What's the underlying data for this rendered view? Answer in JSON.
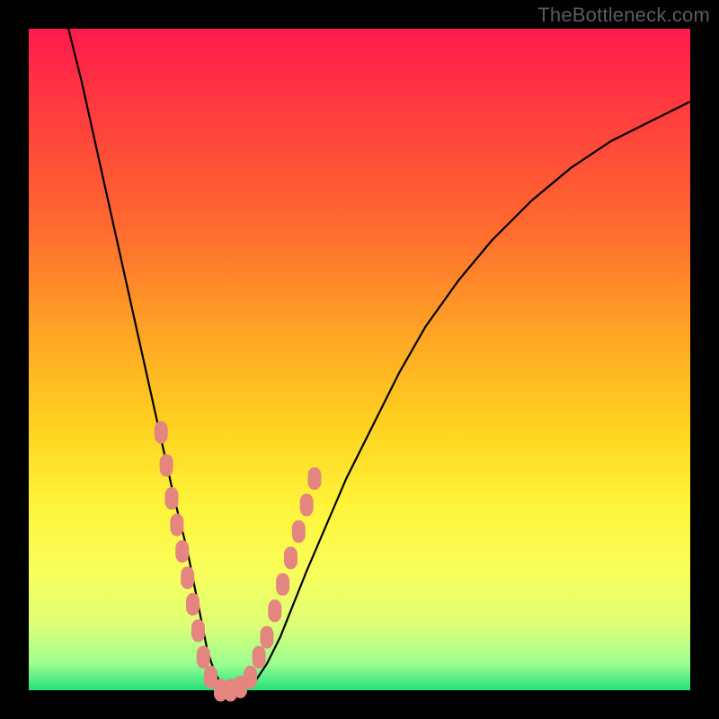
{
  "watermark": "TheBottleneck.com",
  "colors": {
    "frame_bg": "#000000",
    "marker_fill": "#e58580",
    "curve_stroke": "#000000",
    "gradient_top": "#ff1a4d",
    "gradient_bottom": "#23e27a"
  },
  "chart_data": {
    "type": "line",
    "title": "",
    "xlabel": "",
    "ylabel": "",
    "xlim": [
      0,
      100
    ],
    "ylim": [
      0,
      100
    ],
    "grid": false,
    "legend": false,
    "series": [
      {
        "name": "curve",
        "x": [
          6,
          8,
          10,
          12,
          14,
          16,
          18,
          20,
          22,
          23,
          24,
          25,
          26,
          27,
          28,
          29,
          30,
          32,
          34,
          36,
          38,
          40,
          42,
          45,
          48,
          52,
          56,
          60,
          65,
          70,
          76,
          82,
          88,
          94,
          100
        ],
        "y": [
          100,
          92,
          83,
          74,
          65,
          56,
          47,
          38,
          29,
          25,
          21,
          16,
          11,
          6,
          3,
          1,
          0,
          0,
          1,
          4,
          8,
          13,
          18,
          25,
          32,
          40,
          48,
          55,
          62,
          68,
          74,
          79,
          83,
          86,
          89
        ]
      }
    ],
    "markers": [
      {
        "x": 20.0,
        "y": 39
      },
      {
        "x": 20.8,
        "y": 34
      },
      {
        "x": 21.6,
        "y": 29
      },
      {
        "x": 22.4,
        "y": 25
      },
      {
        "x": 23.2,
        "y": 21
      },
      {
        "x": 24.0,
        "y": 17
      },
      {
        "x": 24.8,
        "y": 13
      },
      {
        "x": 25.6,
        "y": 9
      },
      {
        "x": 26.4,
        "y": 5
      },
      {
        "x": 27.5,
        "y": 2
      },
      {
        "x": 29.0,
        "y": 0
      },
      {
        "x": 30.5,
        "y": 0
      },
      {
        "x": 32.0,
        "y": 0.5
      },
      {
        "x": 33.5,
        "y": 2
      },
      {
        "x": 34.8,
        "y": 5
      },
      {
        "x": 36.0,
        "y": 8
      },
      {
        "x": 37.2,
        "y": 12
      },
      {
        "x": 38.4,
        "y": 16
      },
      {
        "x": 39.6,
        "y": 20
      },
      {
        "x": 40.8,
        "y": 24
      },
      {
        "x": 42.0,
        "y": 28
      },
      {
        "x": 43.2,
        "y": 32
      }
    ],
    "annotations": []
  }
}
